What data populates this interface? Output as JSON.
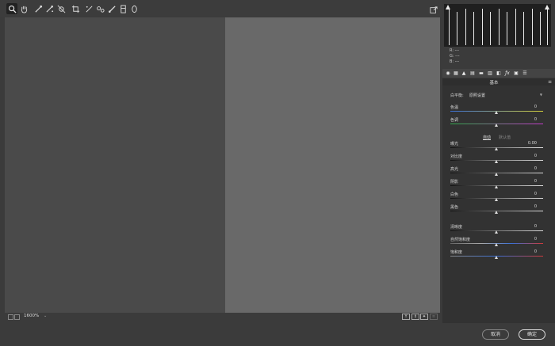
{
  "toolbar": {
    "tools": [
      "zoom-icon",
      "hand-icon",
      "white-balance-icon",
      "color-sampler-icon",
      "target-adjust-icon",
      "crop-icon",
      "straighten-icon",
      "spot-removal-icon",
      "brush-icon",
      "graduated-filter-icon",
      "radial-filter-icon"
    ]
  },
  "status": {
    "zoom": "1600%",
    "zoom_arrow": "⌄",
    "view_y": "Y"
  },
  "readout": {
    "r": "R:    ---",
    "g": "G:    ---",
    "b": "B:    ---"
  },
  "panel": {
    "title": "基本",
    "wb_label": "白平衡:",
    "wb_value": "原照设置",
    "auto": "自动",
    "default": "默认值",
    "sliders": [
      {
        "label": "色温",
        "value": "0",
        "level": 0.5
      },
      {
        "label": "色调",
        "value": "0",
        "level": 0.5
      },
      {
        "label": "曝光",
        "value": "0.00",
        "level": 0.5
      },
      {
        "label": "对比度",
        "value": "0",
        "level": 0.5
      },
      {
        "label": "高光",
        "value": "0",
        "level": 0.5
      },
      {
        "label": "阴影",
        "value": "0",
        "level": 0.5
      },
      {
        "label": "白色",
        "value": "0",
        "level": 0.5
      },
      {
        "label": "黑色",
        "value": "0",
        "level": 0.5
      },
      {
        "label": "清晰度",
        "value": "0",
        "level": 0.5
      },
      {
        "label": "自然饱和度",
        "value": "0",
        "level": 0.5
      },
      {
        "label": "饱和度",
        "value": "0",
        "level": 0.5
      }
    ]
  },
  "buttons": {
    "cancel": "取消",
    "ok": "确定"
  },
  "colors": {
    "accent": "#dddddd",
    "canvas_left": "#4a4a4a",
    "canvas_right": "#696969"
  }
}
